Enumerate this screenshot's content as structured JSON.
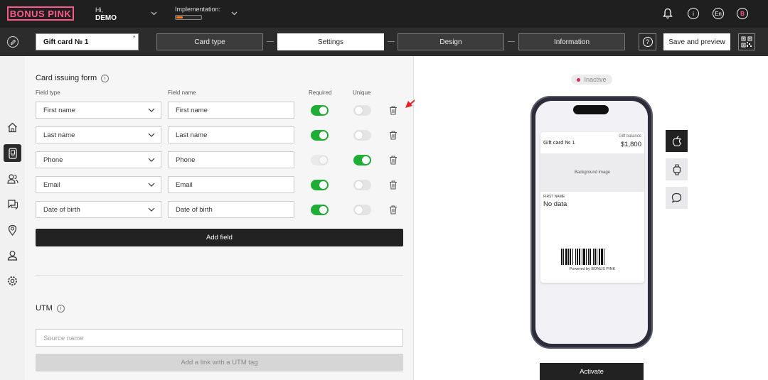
{
  "app": {
    "logo": "BONUS PINK",
    "greeting": "Hi,",
    "user": "DEMO",
    "implementation_label": "Implementation:",
    "implementation_progress": 0.25,
    "language": "En",
    "avatar_letter": "B",
    "icons": [
      "bell-icon",
      "info-icon",
      "language-icon",
      "avatar"
    ]
  },
  "nav": {
    "card_name": "Gift card № 1",
    "steps": [
      {
        "label": "Card type",
        "active": false
      },
      {
        "label": "Settings",
        "active": true
      },
      {
        "label": "Design",
        "active": false
      },
      {
        "label": "Information",
        "active": false
      }
    ],
    "save_label": "Save and preview"
  },
  "sidebar": {
    "items": [
      "home-icon",
      "card-icon",
      "users-icon",
      "chat-icon",
      "location-icon",
      "profile-icon",
      "settings-icon"
    ],
    "active": "card-icon"
  },
  "form": {
    "title": "Card issuing form",
    "col_field_type": "Field type",
    "col_field_name": "Field name",
    "col_required": "Required",
    "col_unique": "Unique",
    "rows": [
      {
        "type": "First name",
        "name": "First name",
        "required": true,
        "unique": false
      },
      {
        "type": "Last name",
        "name": "Last name",
        "required": true,
        "unique": false
      },
      {
        "type": "Phone",
        "name": "Phone",
        "required": true,
        "required_disabled": true,
        "unique": true
      },
      {
        "type": "Email",
        "name": "Email",
        "required": true,
        "unique": false
      },
      {
        "type": "Date of birth",
        "name": "Date of birth",
        "required": true,
        "unique": false
      }
    ],
    "add_field_label": "Add field"
  },
  "utm": {
    "title": "UTM",
    "source_placeholder": "Source name",
    "add_link_label": "Add a link with a UTM tag"
  },
  "preview": {
    "status": "Inactive",
    "status_color": "#e0245e",
    "card_name": "Gift card № 1",
    "balance_label": "Gift balance",
    "balance_value": "$1,800",
    "background_label": "Background image",
    "field_label": "FIRST NAME",
    "field_value": "No data",
    "powered": "Powered by BONUS PINK",
    "platforms": [
      "apple-icon",
      "watch-icon",
      "message-icon"
    ],
    "activate_label": "Activate"
  },
  "colors": {
    "brand": "#ff5a8a",
    "toggle_on": "#1fae35",
    "dark": "#1f1f1f",
    "annotation_arrow": "#e52222"
  }
}
